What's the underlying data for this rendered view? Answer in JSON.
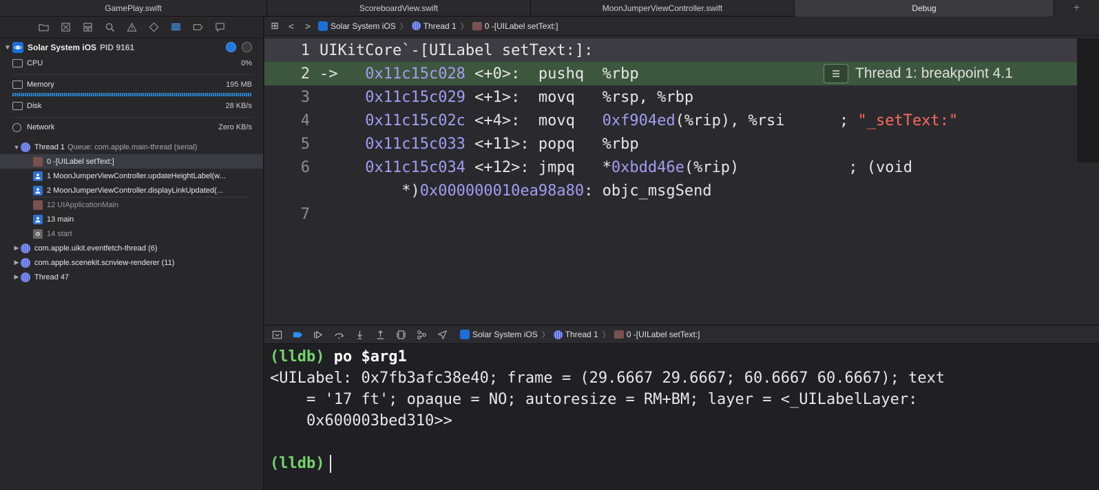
{
  "tabs": [
    {
      "label": "GamePlay.swift",
      "active": false
    },
    {
      "label": "ScoreboardView.swift",
      "active": false
    },
    {
      "label": "MoonJumperViewController.swift",
      "active": false
    },
    {
      "label": "Debug",
      "active": true
    }
  ],
  "tab_add_label": "+",
  "navigator_icons": [
    "folder-icon",
    "source-control-icon",
    "symbol-icon",
    "search-icon",
    "warning-icon",
    "test-icon",
    "debug-navigator-icon",
    "breakpoint-icon",
    "report-icon"
  ],
  "process": {
    "name": "Solar System iOS",
    "pid": "PID 9161"
  },
  "gauges": {
    "cpu": {
      "label": "CPU",
      "value": "0%"
    },
    "memory": {
      "label": "Memory",
      "value": "195 MB"
    },
    "disk": {
      "label": "Disk",
      "value": "28 KB/s"
    },
    "network": {
      "label": "Network",
      "value": "Zero KB/s"
    }
  },
  "thread1": {
    "name": "Thread 1",
    "queue": "Queue: com.apple.main-thread (serial)",
    "frames": [
      {
        "label": "0 -[UILabel setText:]",
        "kind": "sys"
      },
      {
        "label": "1 MoonJumperViewController.updateHeightLabel(w...",
        "kind": "user"
      },
      {
        "label": "2 MoonJumperViewController.displayLinkUpdated(...",
        "kind": "user"
      },
      {
        "label": "12 UIApplicationMain",
        "kind": "sys"
      },
      {
        "label": "13 main",
        "kind": "user"
      },
      {
        "label": "14 start",
        "kind": "gear"
      }
    ]
  },
  "other_threads": [
    "com.apple.uikit.eventfetch-thread (6)",
    "com.apple.scenekit.scnview-renderer (11)",
    "Thread 47"
  ],
  "jumpbar": {
    "grid_label": "⊞",
    "back_label": "<",
    "forward_label": ">",
    "crumbs": [
      "Solar System iOS",
      "Thread 1",
      "0 -[UILabel setText:]"
    ]
  },
  "code": {
    "line1": {
      "num": "1",
      "text": "UIKitCore`-[UILabel setText:]:"
    },
    "line2": {
      "num": "2",
      "arrow": "->   ",
      "addr": "0x11c15c028",
      "rest": " <+0>:  pushq  %rbp"
    },
    "line3": {
      "num": "3",
      "pad": "     ",
      "addr": "0x11c15c029",
      "rest": " <+1>:  movq   %rsp, %rbp"
    },
    "line4": {
      "num": "4",
      "pad": "     ",
      "addr": "0x11c15c02c",
      "rest": " <+4>:  movq   ",
      "addr2": "0xf904ed",
      "rest2": "(%rip), %rsi      ; ",
      "str": "\"_setText:\""
    },
    "line5": {
      "num": "5",
      "pad": "     ",
      "addr": "0x11c15c033",
      "rest": " <+11>: popq   %rbp"
    },
    "line6": {
      "num": "6",
      "pad": "     ",
      "addr": "0x11c15c034",
      "rest": " <+12>: jmpq   *",
      "addr2": "0xbdd46e",
      "rest2": "(%rip)            ; (void"
    },
    "line6b": {
      "pad": "         *)",
      "addr": "0x000000010ea98a80",
      "rest": ": objc_msgSend"
    },
    "line7": {
      "num": "7"
    }
  },
  "breakpoint_badge": "Thread 1: breakpoint 4.1",
  "debug_toolbar": {
    "crumbs": [
      "Solar System iOS",
      "Thread 1",
      "0 -[UILabel setText:]"
    ]
  },
  "console": {
    "prompt": "(lldb)",
    "command": " po $arg1",
    "output": [
      "<UILabel: 0x7fb3afc38e40; frame = (29.6667 29.6667; 60.6667 60.6667); text",
      "    = '17 ft'; opaque = NO; autoresize = RM+BM; layer = <_UILabelLayer:",
      "    0x600003bed310>>",
      ""
    ],
    "prompt2": "(lldb)"
  }
}
